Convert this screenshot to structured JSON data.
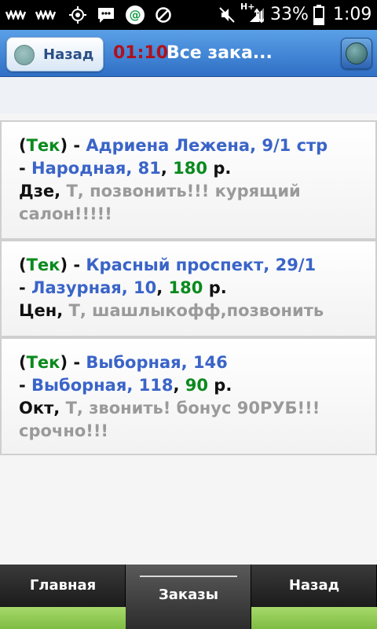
{
  "status_bar": {
    "left_icons": [
      "wavy-signal-icon",
      "wavy-signal-icon",
      "gps-icon",
      "chat-icon",
      "email-at-icon",
      "blocked-icon"
    ],
    "right_icons": [
      "mute-icon",
      "network-icon",
      "signal-bars-icon",
      "battery-icon"
    ],
    "network_type": "H+",
    "battery": "33%",
    "time": "1:09"
  },
  "header": {
    "back_label": "Назад",
    "timer": "01:10",
    "title": "Все зака...",
    "colors": {
      "bar": "#3f80d4",
      "timer": "#b0101a"
    }
  },
  "orders": [
    {
      "status": "Тек",
      "from": "Адриена Лежена, 9/1 стр",
      "to": "Народная, 81",
      "price": "180",
      "currency": "р.",
      "client": "Дзе",
      "tariff": "Т",
      "note_line1": "позвонить!!! курящий",
      "note_line2": "салон!!!!!"
    },
    {
      "status": "Тек",
      "from": "Красный проспект, 29/1",
      "to": "Лазурная, 10",
      "price": "180",
      "currency": "р.",
      "client": "Цен",
      "tariff": "Т",
      "note_line1": "шашлыкофф,позвонить",
      "note_line2": ""
    },
    {
      "status": "Тек",
      "from": "Выборная, 146",
      "to": "Выборная, 118",
      "price": "90",
      "currency": "р.",
      "client": "Окт",
      "tariff": "Т",
      "note_line1": "звонить! бонус 90РУБ!!!",
      "note_line2": "срочно!!!"
    }
  ],
  "bottom_nav": {
    "tabs": [
      {
        "label": "Главная",
        "active": false
      },
      {
        "label": "Заказы",
        "active": true
      },
      {
        "label": "Назад",
        "active": false
      }
    ]
  }
}
